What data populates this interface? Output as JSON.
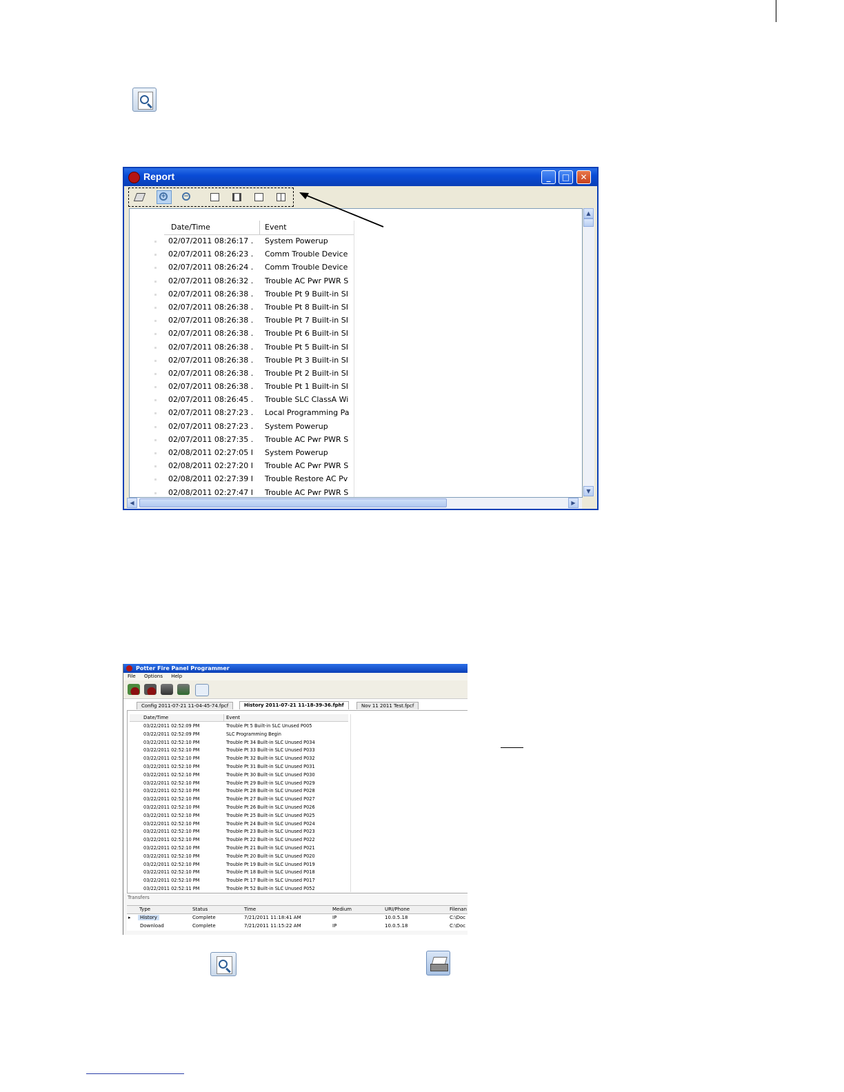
{
  "report_window": {
    "title": "Report",
    "columns": {
      "date_time": "Date/Time",
      "event": "Event"
    },
    "rows": [
      {
        "dt": "02/07/2011 08:26:17 .",
        "ev": "System Powerup"
      },
      {
        "dt": "02/07/2011 08:26:23 .",
        "ev": "Comm Trouble Device"
      },
      {
        "dt": "02/07/2011 08:26:24 .",
        "ev": "Comm Trouble Device"
      },
      {
        "dt": "02/07/2011 08:26:32 .",
        "ev": "Trouble AC Pwr PWR S"
      },
      {
        "dt": "02/07/2011 08:26:38 .",
        "ev": "Trouble Pt 9 Built-in SI"
      },
      {
        "dt": "02/07/2011 08:26:38 .",
        "ev": "Trouble Pt 8 Built-in SI"
      },
      {
        "dt": "02/07/2011 08:26:38 .",
        "ev": "Trouble Pt 7 Built-in SI"
      },
      {
        "dt": "02/07/2011 08:26:38 .",
        "ev": "Trouble Pt 6 Built-in SI"
      },
      {
        "dt": "02/07/2011 08:26:38 .",
        "ev": "Trouble Pt 5 Built-in SI"
      },
      {
        "dt": "02/07/2011 08:26:38 .",
        "ev": "Trouble Pt 3 Built-in SI"
      },
      {
        "dt": "02/07/2011 08:26:38 .",
        "ev": "Trouble Pt 2 Built-in SI"
      },
      {
        "dt": "02/07/2011 08:26:38 .",
        "ev": "Trouble Pt 1 Built-in SI"
      },
      {
        "dt": "02/07/2011 08:26:45 .",
        "ev": "Trouble SLC ClassA Wi"
      },
      {
        "dt": "02/07/2011 08:27:23 .",
        "ev": "Local Programming Pa"
      },
      {
        "dt": "02/07/2011 08:27:23 .",
        "ev": "System Powerup"
      },
      {
        "dt": "02/07/2011 08:27:35 .",
        "ev": "Trouble AC Pwr PWR S"
      },
      {
        "dt": "02/08/2011 02:27:05 I",
        "ev": "System Powerup"
      },
      {
        "dt": "02/08/2011 02:27:20 I",
        "ev": "Trouble AC Pwr PWR S"
      },
      {
        "dt": "02/08/2011 02:27:39 I",
        "ev": "Trouble Restore AC Pv"
      },
      {
        "dt": "02/08/2011 02:27:47 I",
        "ev": "Trouble AC Pwr PWR S"
      }
    ]
  },
  "programmer_window": {
    "title": "Potter Fire Panel Programmer",
    "menu": [
      "File",
      "Options",
      "Help"
    ],
    "tabs": [
      "Config 2011-07-21 11-04-45-74.fpcf",
      "History 2011-07-21 11-18-39-36.fphf",
      "Nov 11 2011 Test.fpcf"
    ],
    "columns": {
      "date_time": "Date/Time",
      "event": "Event"
    },
    "rows": [
      {
        "dt": "03/22/2011 02:52:09 PM",
        "ev": "Trouble Pt 5 Built-in SLC Unused P005"
      },
      {
        "dt": "03/22/2011 02:52:09 PM",
        "ev": "SLC Programming Begin"
      },
      {
        "dt": "03/22/2011 02:52:10 PM",
        "ev": "Trouble Pt 34 Built-in SLC Unused P034"
      },
      {
        "dt": "03/22/2011 02:52:10 PM",
        "ev": "Trouble Pt 33 Built-in SLC Unused P033"
      },
      {
        "dt": "03/22/2011 02:52:10 PM",
        "ev": "Trouble Pt 32 Built-in SLC Unused P032"
      },
      {
        "dt": "03/22/2011 02:52:10 PM",
        "ev": "Trouble Pt 31 Built-in SLC Unused P031"
      },
      {
        "dt": "03/22/2011 02:52:10 PM",
        "ev": "Trouble Pt 30 Built-in SLC Unused P030"
      },
      {
        "dt": "03/22/2011 02:52:10 PM",
        "ev": "Trouble Pt 29 Built-in SLC Unused P029"
      },
      {
        "dt": "03/22/2011 02:52:10 PM",
        "ev": "Trouble Pt 28 Built-in SLC Unused P028"
      },
      {
        "dt": "03/22/2011 02:52:10 PM",
        "ev": "Trouble Pt 27 Built-in SLC Unused P027"
      },
      {
        "dt": "03/22/2011 02:52:10 PM",
        "ev": "Trouble Pt 26 Built-in SLC Unused P026"
      },
      {
        "dt": "03/22/2011 02:52:10 PM",
        "ev": "Trouble Pt 25 Built-in SLC Unused P025"
      },
      {
        "dt": "03/22/2011 02:52:10 PM",
        "ev": "Trouble Pt 24 Built-in SLC Unused P024"
      },
      {
        "dt": "03/22/2011 02:52:10 PM",
        "ev": "Trouble Pt 23 Built-in SLC Unused P023"
      },
      {
        "dt": "03/22/2011 02:52:10 PM",
        "ev": "Trouble Pt 22 Built-in SLC Unused P022"
      },
      {
        "dt": "03/22/2011 02:52:10 PM",
        "ev": "Trouble Pt 21 Built-in SLC Unused P021"
      },
      {
        "dt": "03/22/2011 02:52:10 PM",
        "ev": "Trouble Pt 20 Built-in SLC Unused P020"
      },
      {
        "dt": "03/22/2011 02:52:10 PM",
        "ev": "Trouble Pt 19 Built-in SLC Unused P019"
      },
      {
        "dt": "03/22/2011 02:52:10 PM",
        "ev": "Trouble Pt 18 Built-in SLC Unused P018"
      },
      {
        "dt": "03/22/2011 02:52:10 PM",
        "ev": "Trouble Pt 17 Built-in SLC Unused P017"
      },
      {
        "dt": "03/22/2011 02:52:11 PM",
        "ev": "Trouble Pt 52 Built-in SLC Unused P052"
      }
    ],
    "transfers": {
      "label": "Transfers",
      "columns": [
        "Type",
        "Status",
        "Time",
        "Medium",
        "URI/Phone",
        "Filenan"
      ],
      "rows": [
        {
          "type": "History",
          "status": "Complete",
          "time": "7/21/2011 11:18:41 AM",
          "medium": "IP",
          "uri": "10.0.5.18",
          "file": "C:\\Doc"
        },
        {
          "type": "Download",
          "status": "Complete",
          "time": "7/21/2011 11:15:22 AM",
          "medium": "IP",
          "uri": "10.0.5.18",
          "file": "C:\\Doc"
        }
      ]
    }
  },
  "icons": [
    "report-preview-icon",
    "print-icon",
    "zoom-in-icon",
    "zoom-out-icon"
  ]
}
